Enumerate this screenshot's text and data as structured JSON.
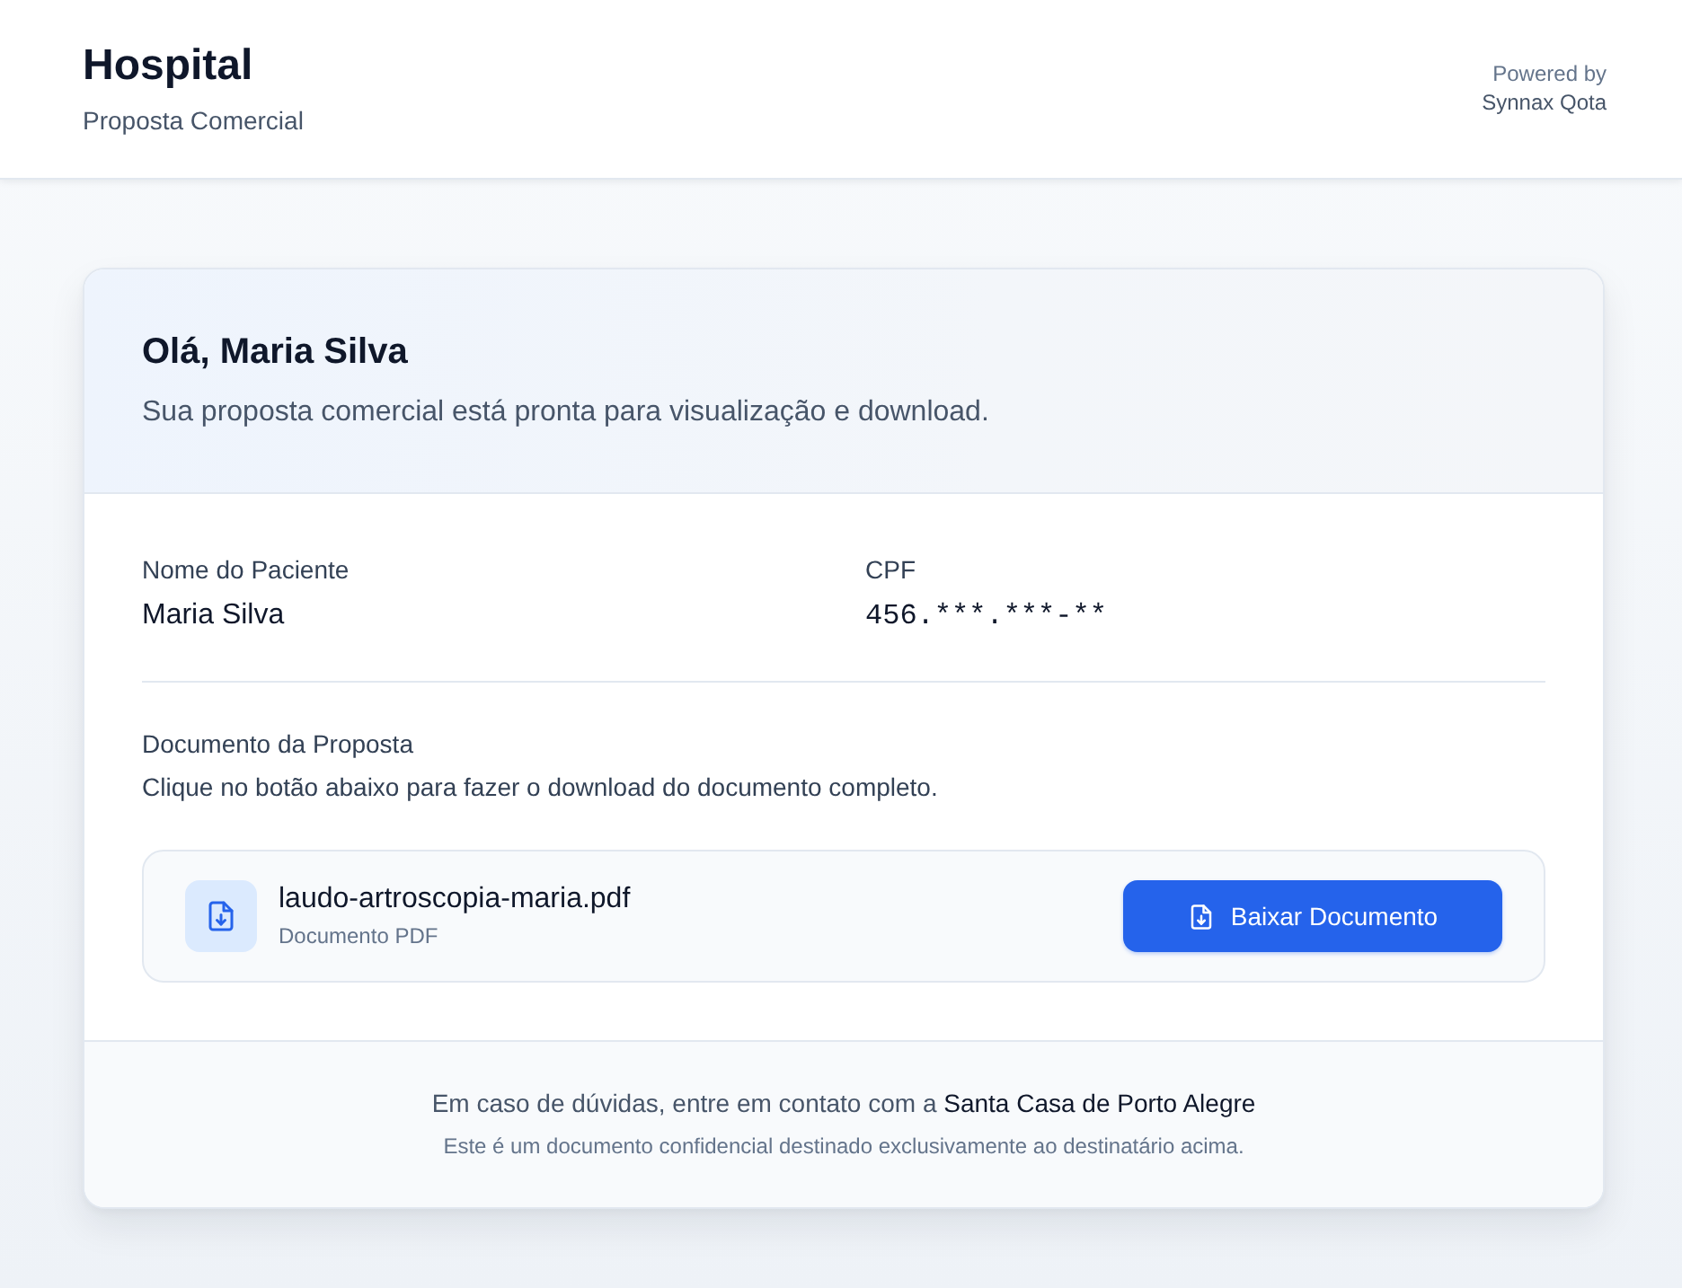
{
  "header": {
    "title": "Hospital",
    "subtitle": "Proposta Comercial",
    "powered_by": "Powered by",
    "brand": "Synnax Qota"
  },
  "greeting": {
    "title": "Olá, Maria Silva",
    "message": "Sua proposta comercial está pronta para visualização e download."
  },
  "fields": [
    {
      "label": "Nome do Paciente",
      "value": "Maria Silva",
      "kind": "text"
    },
    {
      "label": "CPF",
      "value": "456.***.***-**",
      "kind": "masked"
    }
  ],
  "document": {
    "title": "Documento da Proposta",
    "description": "Clique no botão abaixo para fazer o download do documento completo.",
    "file_name": "laudo-artroscopia-maria.pdf",
    "file_type": "Documento PDF",
    "button": "Baixar Documento"
  },
  "footer": {
    "contact": "Em caso de dúvidas, entre em contato com a **Santa Casa de Porto Alegre**",
    "notice": "Este é um documento confidencial destinado exclusivamente ao destinatário acima."
  }
}
